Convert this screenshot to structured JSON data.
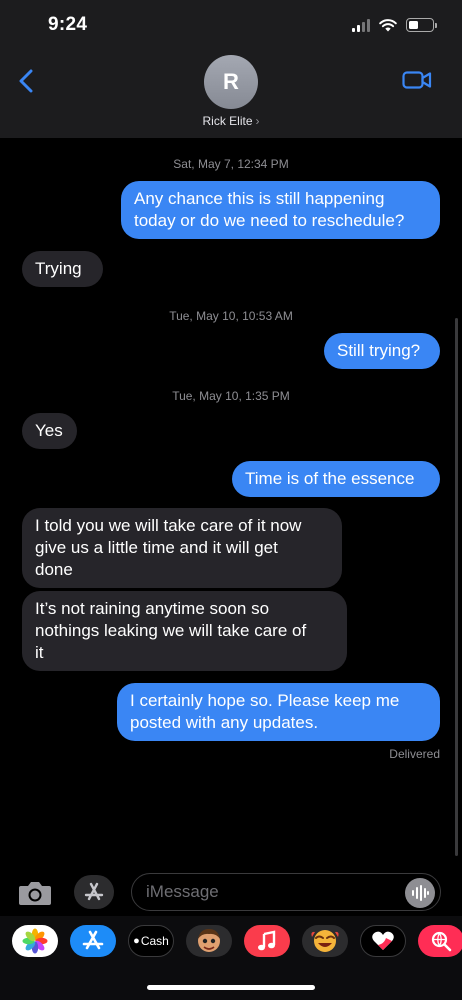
{
  "status_bar": {
    "time": "9:24"
  },
  "header": {
    "avatar_initial": "R",
    "contact_name": "Rick Elite",
    "contact_chevron": "›"
  },
  "messages": [
    {
      "type": "timestamp",
      "text": "Sat, May 7, 12:34 PM"
    },
    {
      "type": "out",
      "lines": [
        "Any chance this is still happening",
        "today or do we need to reschedule?"
      ]
    },
    {
      "type": "in",
      "lines": [
        "Trying"
      ]
    },
    {
      "type": "timestamp",
      "text": "Tue, May 10, 10:53 AM"
    },
    {
      "type": "out",
      "lines": [
        "Still trying?"
      ]
    },
    {
      "type": "timestamp",
      "text": "Tue, May 10, 1:35 PM"
    },
    {
      "type": "in",
      "lines": [
        "Yes"
      ]
    },
    {
      "type": "out",
      "lines": [
        "Time is of the essence"
      ]
    },
    {
      "type": "in",
      "lines": [
        "I told you we will take care of it now",
        "give us a little time and it will get",
        "done"
      ]
    },
    {
      "type": "in",
      "lines": [
        "It’s not raining anytime soon so",
        "nothings leaking we will take care of",
        "it"
      ]
    },
    {
      "type": "out",
      "lines": [
        "I certainly hope so.  Please keep me",
        "posted with any updates."
      ]
    }
  ],
  "delivery_status": "Delivered",
  "input_bar": {
    "placeholder": "iMessage"
  },
  "app_drawer": {
    "apps": [
      "photos",
      "app-store",
      "apple-cash",
      "memoji",
      "music",
      "animoji",
      "digital-touch",
      "search-images"
    ],
    "cash_label": "Cash"
  },
  "colors": {
    "outgoing_bubble": "#3a86f4",
    "incoming_bubble": "#26252a",
    "accent": "#3a86f4",
    "header_bg": "#1c1c1e"
  }
}
